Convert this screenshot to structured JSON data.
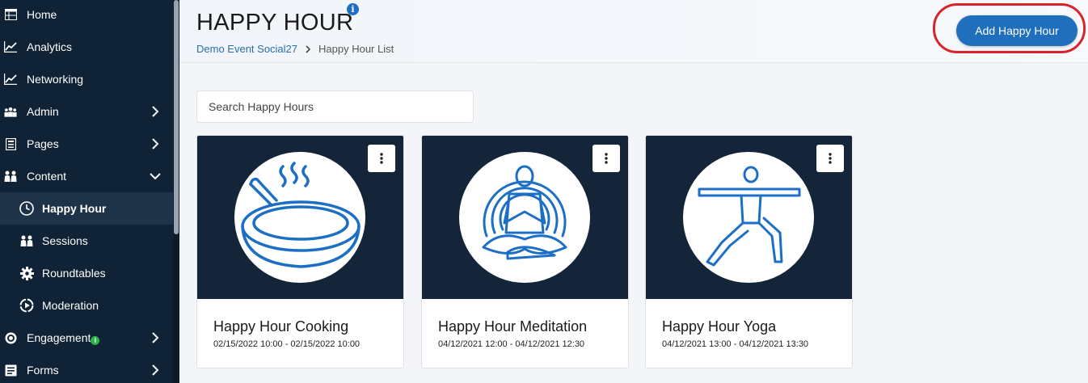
{
  "sidebar": {
    "items": [
      {
        "label": "Home",
        "icon": "table-icon"
      },
      {
        "label": "Analytics",
        "icon": "chart-icon"
      },
      {
        "label": "Networking",
        "icon": "chart-icon"
      },
      {
        "label": "Admin",
        "icon": "users-icon"
      },
      {
        "label": "Pages",
        "icon": "page-icon"
      },
      {
        "label": "Content",
        "icon": "people-icon"
      },
      {
        "label": "Happy Hour",
        "icon": "clock-icon",
        "active": true
      },
      {
        "label": "Sessions",
        "icon": "people-icon"
      },
      {
        "label": "Roundtables",
        "icon": "gear-icon"
      },
      {
        "label": "Moderation",
        "icon": "moderation-icon"
      },
      {
        "label": "Engagement",
        "icon": "target-icon",
        "badge": "i"
      },
      {
        "label": "Forms",
        "icon": "form-icon"
      }
    ]
  },
  "header": {
    "title": "HAPPY HOUR",
    "info_icon": "i",
    "breadcrumb": [
      "Demo Event Social27",
      "Happy Hour List"
    ],
    "add_button": "Add Happy Hour"
  },
  "search": {
    "placeholder": "Search Happy Hours"
  },
  "cards": [
    {
      "title": "Happy Hour Cooking",
      "dates": "02/15/2022 10:00 - 02/15/2022 10:00",
      "icon": "frying-pan-icon"
    },
    {
      "title": "Happy Hour Meditation",
      "dates": "04/12/2021 12:00 - 04/12/2021 12:30",
      "icon": "meditation-icon"
    },
    {
      "title": "Happy Hour Yoga",
      "dates": "04/12/2021 13:00 - 04/12/2021 13:30",
      "icon": "yoga-icon"
    }
  ],
  "colors": {
    "sidebar": "#0f2236",
    "accent": "#1f6fbd",
    "highlight": "#d9232a",
    "icon_blue": "#1c6fc4"
  }
}
